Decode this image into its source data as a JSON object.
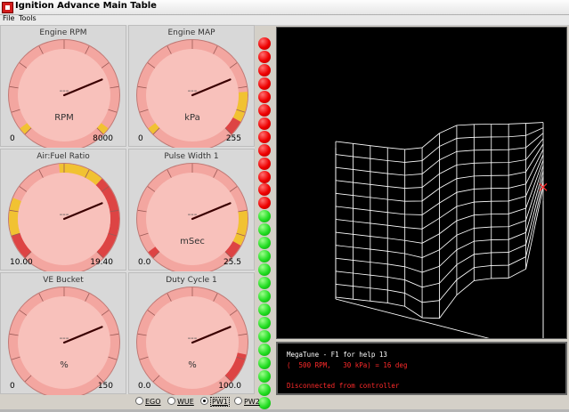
{
  "window": {
    "title": "Ignition Advance Main Table",
    "menus": [
      "File",
      "Tools"
    ]
  },
  "colors": {
    "gauge_face": "#f8c1bb",
    "gauge_ring": "#f3a6a0",
    "warn_yellow": "#f1c232",
    "danger_red": "#dd4444",
    "led_red": "#ee0000",
    "led_green": "#22dd22"
  },
  "gauges": [
    {
      "id": "rpm",
      "title": "Engine RPM",
      "units": "RPM",
      "value_text": "---",
      "min_label": "0",
      "max_label": "8000",
      "needle_fraction": 0.75,
      "bands": [
        {
          "from": 0.0,
          "to": 0.03,
          "color": "#f1c232"
        },
        {
          "from": 0.97,
          "to": 1.0,
          "color": "#f1c232"
        }
      ]
    },
    {
      "id": "map",
      "title": "Engine MAP",
      "units": "kPa",
      "value_text": "---",
      "min_label": "0",
      "max_label": "255",
      "needle_fraction": 0.75,
      "bands": [
        {
          "from": 0.0,
          "to": 0.03,
          "color": "#f1c232"
        },
        {
          "from": 0.82,
          "to": 0.94,
          "color": "#f1c232"
        },
        {
          "from": 0.94,
          "to": 1.0,
          "color": "#dd4444"
        }
      ]
    },
    {
      "id": "afr",
      "title": "Air:Fuel Ratio",
      "units": "",
      "value_text": "---",
      "min_label": "10.00",
      "max_label": "19.40",
      "needle_fraction": 0.75,
      "bands": [
        {
          "from": 0.0,
          "to": 0.1,
          "color": "#dd4444"
        },
        {
          "from": 0.1,
          "to": 0.25,
          "color": "#f1c232"
        },
        {
          "from": 0.48,
          "to": 0.66,
          "color": "#f1c232"
        },
        {
          "from": 0.66,
          "to": 1.0,
          "color": "#dd4444"
        }
      ]
    },
    {
      "id": "pw1",
      "title": "Pulse Width 1",
      "units": "mSec",
      "value_text": "---",
      "min_label": "0.0",
      "max_label": "25.5",
      "needle_fraction": 0.75,
      "bands": [
        {
          "from": 0.0,
          "to": 0.03,
          "color": "#dd4444"
        },
        {
          "from": 0.8,
          "to": 0.94,
          "color": "#f1c232"
        },
        {
          "from": 0.94,
          "to": 1.0,
          "color": "#dd4444"
        }
      ]
    },
    {
      "id": "ve",
      "title": "VE Bucket",
      "units": "%",
      "value_text": "---",
      "min_label": "0",
      "max_label": "150",
      "needle_fraction": 0.75,
      "bands": []
    },
    {
      "id": "duty",
      "title": "Duty Cycle 1",
      "units": "%",
      "value_text": "---",
      "min_label": "0.0",
      "max_label": "100.0",
      "needle_fraction": 0.75,
      "bands": [
        {
          "from": 0.88,
          "to": 1.0,
          "color": "#dd4444"
        }
      ]
    }
  ],
  "indicator_leds": [
    "red",
    "red",
    "red",
    "red",
    "red",
    "red",
    "red",
    "red",
    "red",
    "red",
    "red",
    "red",
    "red",
    "green",
    "green",
    "green",
    "green",
    "green",
    "green",
    "green",
    "green",
    "green",
    "green",
    "green",
    "green",
    "green",
    "green",
    "green"
  ],
  "console": {
    "line1": "MegaTune - F1 for help 13",
    "line2": "(  500 RPM,   30 kPa) = 16 deg",
    "line3": "Disconnected from controller"
  },
  "radio_group": [
    {
      "label": "EGO",
      "checked": false
    },
    {
      "label": "WUE",
      "checked": false
    },
    {
      "label": "PW1",
      "checked": true
    },
    {
      "label": "PW2",
      "checked": false
    }
  ]
}
